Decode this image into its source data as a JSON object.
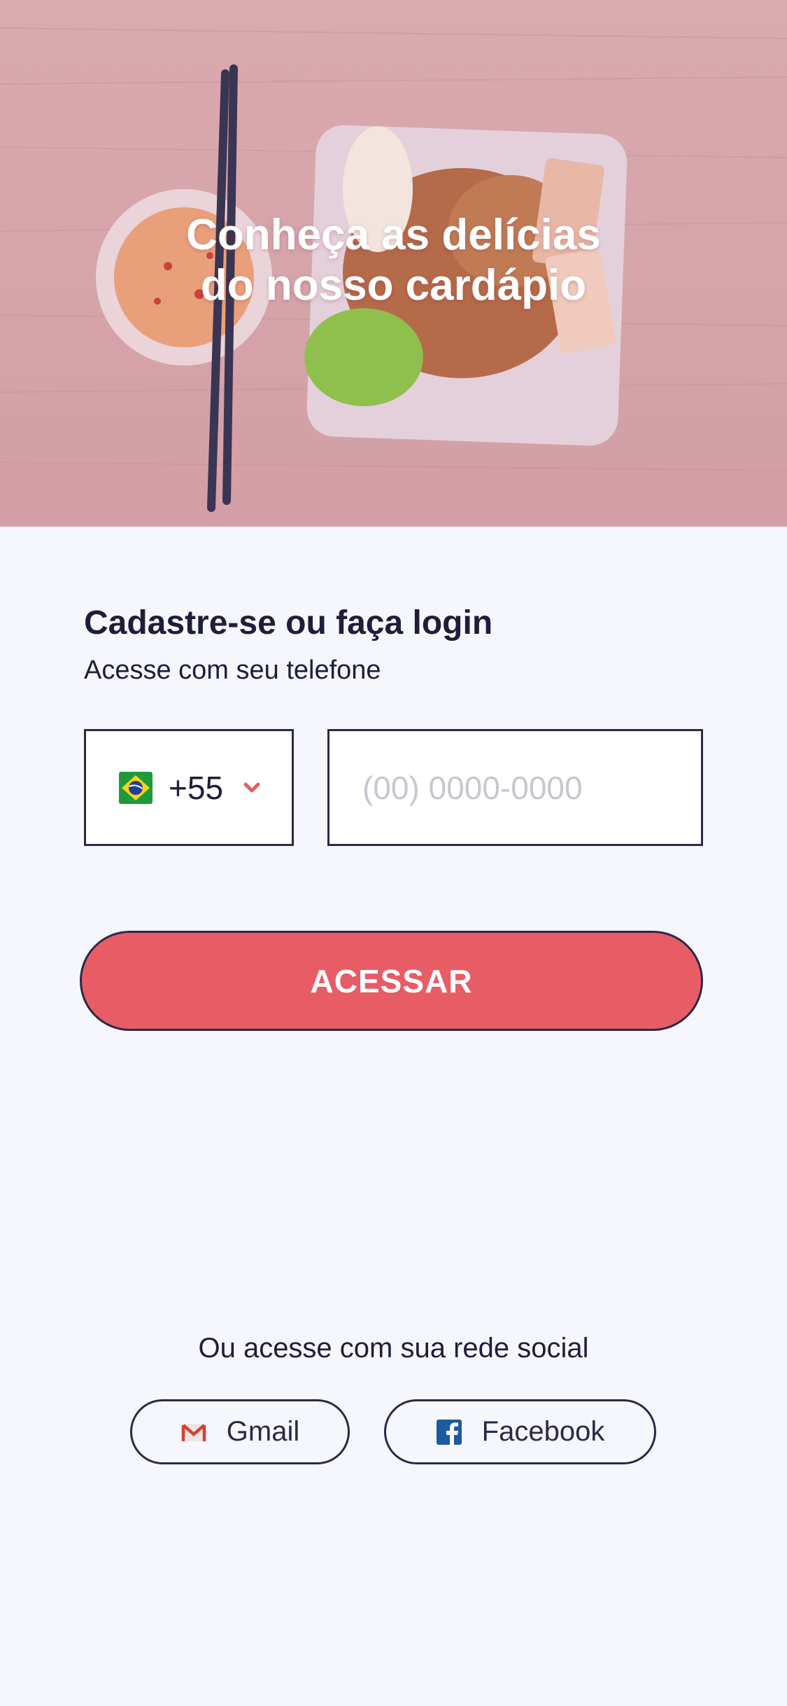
{
  "hero": {
    "title_line1": "Conheça as delícias",
    "title_line2": "do nosso cardápio",
    "overlay_color": "#d59ea7"
  },
  "login": {
    "title": "Cadastre-se ou faça login",
    "subtitle": "Acesse com seu telefone",
    "country": {
      "flag": "brazil-flag-icon",
      "code": "+55",
      "dropdown_icon": "chevron-down-icon"
    },
    "phone": {
      "value": "",
      "placeholder": "(00) 0000-0000"
    },
    "submit_label": "ACESSAR"
  },
  "social": {
    "title": "Ou acesse com sua rede social",
    "buttons": [
      {
        "label": "Gmail",
        "icon": "gmail-icon"
      },
      {
        "label": "Facebook",
        "icon": "facebook-icon"
      }
    ]
  },
  "colors": {
    "accent": "#e85c66",
    "text": "#1f1d3a",
    "border": "#2b2948",
    "background": "#f6f6fd",
    "placeholder": "#c8c7d1",
    "facebook_blue": "#1d5a9e"
  }
}
